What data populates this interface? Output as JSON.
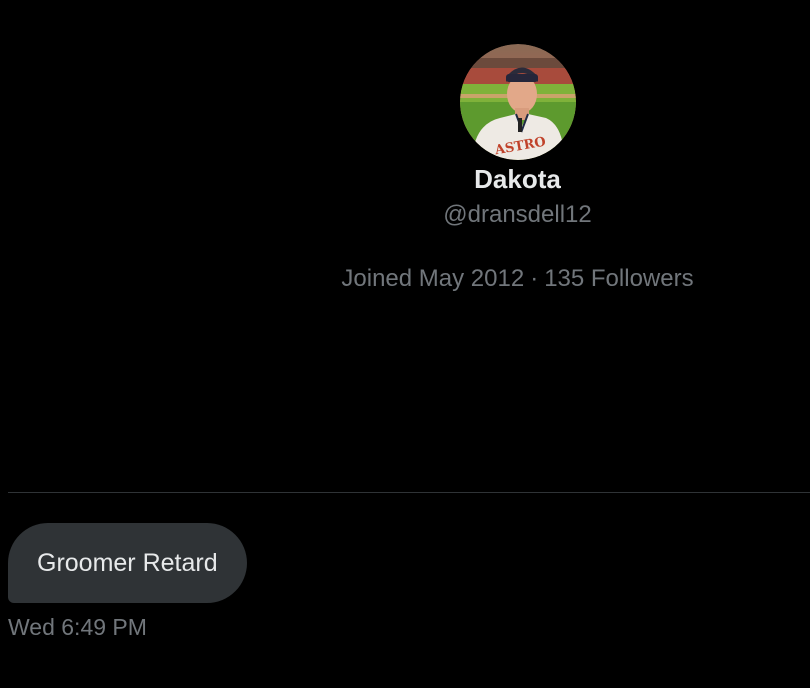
{
  "profile": {
    "display_name": "Dakota",
    "handle": "@dransdell12",
    "joined": "Joined May 2012",
    "separator": "·",
    "followers": "135 Followers",
    "avatar_icon": "profile-photo-avatar"
  },
  "conversation": {
    "messages": [
      {
        "text": "Groomer Retard",
        "timestamp": "Wed 6:49 PM"
      }
    ]
  },
  "colors": {
    "background": "#000000",
    "primary_text": "#e7e9ea",
    "secondary_text": "#71767b",
    "bubble": "#2f3336"
  }
}
